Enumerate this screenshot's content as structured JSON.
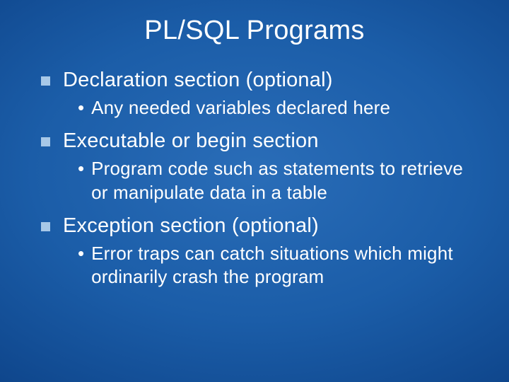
{
  "slide": {
    "title": "PL/SQL Programs",
    "items": [
      {
        "text": "Declaration section (optional)",
        "sub": "Any needed variables declared here"
      },
      {
        "text": "Executable or begin section",
        "sub": "Program code such as statements to retrieve or manipulate data in a table"
      },
      {
        "text": "Exception section (optional)",
        "sub": "Error traps can catch situations which might ordinarily crash the program"
      }
    ]
  }
}
